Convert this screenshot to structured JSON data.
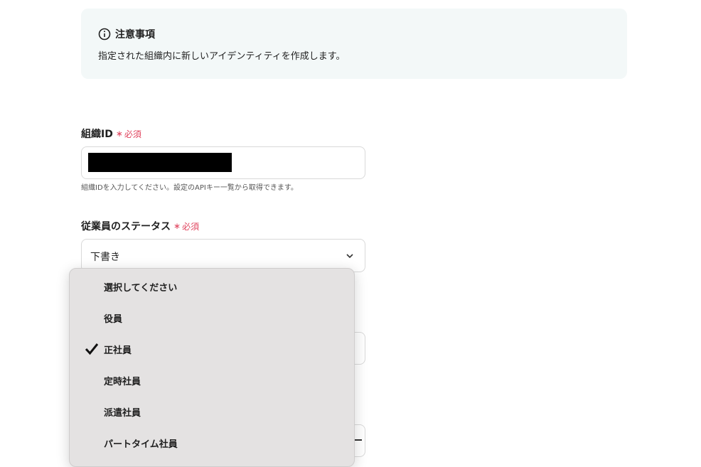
{
  "notice": {
    "title": "注意事項",
    "text": "指定された組織内に新しいアイデンティティを作成します。"
  },
  "org_id": {
    "label": "組織ID",
    "required": "必須",
    "hint": "組織IDを入力してください。設定のAPIキー一覧から取得できます。"
  },
  "status": {
    "label": "従業員のステータス",
    "required": "必須",
    "value": "下書き",
    "options": [
      {
        "label": "選択してください",
        "selected": false
      },
      {
        "label": "役員",
        "selected": false
      },
      {
        "label": "正社員",
        "selected": true
      },
      {
        "label": "定時社員",
        "selected": false
      },
      {
        "label": "派遣社員",
        "selected": false
      },
      {
        "label": "パートタイム社員",
        "selected": false
      }
    ]
  },
  "icons": {
    "notice": "info-circle-icon",
    "select": "chevron-down-icon",
    "check": "checkmark-icon"
  },
  "colors": {
    "required": "#e0445e",
    "notice_bg": "#f3f8f8",
    "dropdown_bg": "#e4e2e2"
  }
}
